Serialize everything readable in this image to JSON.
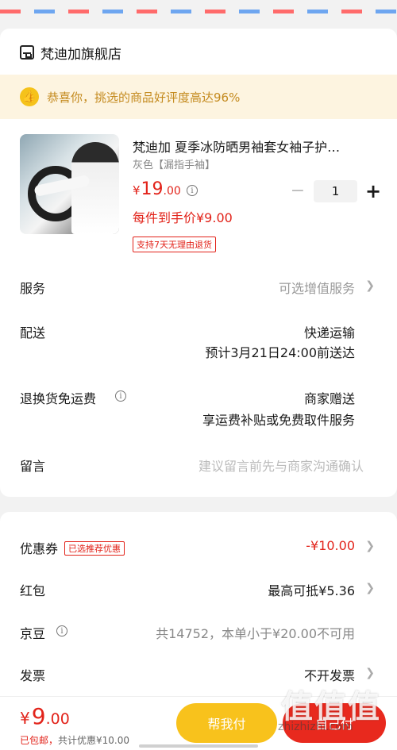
{
  "shop": {
    "name": "梵迪加旗舰店"
  },
  "banner": {
    "text": "恭喜你，挑选的商品好评度高达96%"
  },
  "product": {
    "title": "梵迪加 夏季冰防晒男袖套女袖子护…",
    "spec": "灰色【漏指手袖】",
    "price_currency": "¥",
    "price_int": "19",
    "price_dec": ".00",
    "per_unit": "每件到手价¥9.00",
    "return_tag": "支持7天无理由退货",
    "quantity": "1",
    "minus": "−",
    "plus": "+"
  },
  "rows": {
    "service_label": "服务",
    "service_value": "可选增值服务",
    "delivery_label": "配送",
    "delivery_method": "快递运输",
    "delivery_eta": "预计3月21日24:00前送达",
    "return_label": "退换货免运费",
    "return_value1": "商家赠送",
    "return_value2": "享运费补贴或免费取件服务",
    "note_label": "留言",
    "note_placeholder": "建议留言前先与商家沟通确认"
  },
  "discounts": {
    "coupon_label": "优惠券",
    "coupon_tag": "已选推荐优惠",
    "coupon_value": "-¥10.00",
    "redpacket_label": "红包",
    "redpacket_value": "最高可抵¥5.36",
    "jd_bean_label": "京豆",
    "jd_bean_value": "共14752，本单小于¥20.00不可用",
    "invoice_label": "发票",
    "invoice_value": "不开发票"
  },
  "footer": {
    "total_currency": "¥",
    "total_int": "9",
    "total_dec": ".00",
    "shipping": "已包邮，",
    "discount_total": "共计优惠¥10.00",
    "help_pay": "帮我付",
    "self_pay": "自己付"
  },
  "watermark": {
    "big": "值值值",
    "small": "zhizhizhi.com"
  },
  "colors": {
    "accent_red": "#e2231a",
    "banner_bg": "#fdf4e0",
    "yellow_btn": "#f8c21c"
  }
}
